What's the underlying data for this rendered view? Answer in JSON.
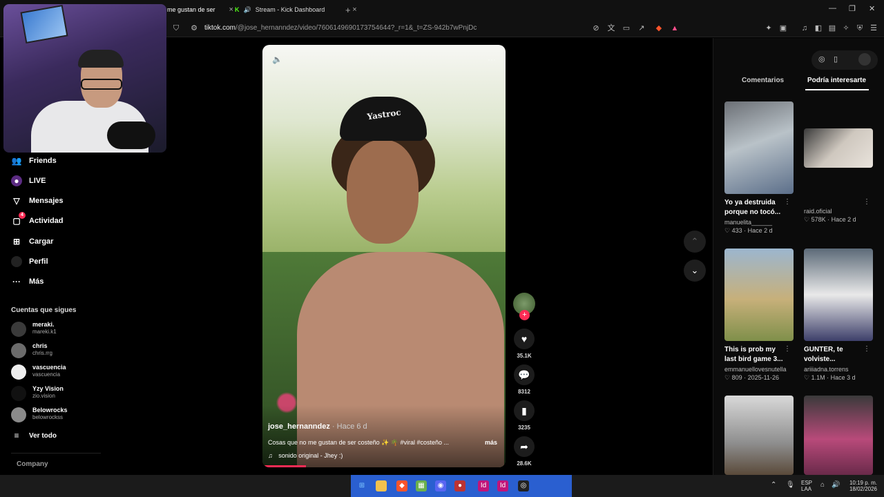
{
  "browser": {
    "tabs": [
      {
        "label": "me gustan de ser",
        "active": true
      },
      {
        "label": "Stream - Kick Dashboard",
        "active": false
      }
    ],
    "url_domain": "tiktok.com",
    "url_path": "/@jose_hernanndez/video/7606149690173754644?_r=1&_t=ZS-942b7wPnjDc"
  },
  "sidebar": {
    "items": [
      {
        "label": "Friends",
        "icon": "friends-icon"
      },
      {
        "label": "LIVE",
        "icon": "live-icon"
      },
      {
        "label": "Mensajes",
        "icon": "messages-icon"
      },
      {
        "label": "Actividad",
        "icon": "activity-icon",
        "badge": "4"
      },
      {
        "label": "Cargar",
        "icon": "upload-icon"
      },
      {
        "label": "Perfil",
        "icon": "profile-icon"
      },
      {
        "label": "Más",
        "icon": "more-icon"
      }
    ],
    "following_title": "Cuentas que sigues",
    "following": [
      {
        "name": "meraki.",
        "handle": "mareki.k1"
      },
      {
        "name": "chris",
        "handle": "chris.rrg"
      },
      {
        "name": "vascuencia",
        "handle": "vascuencia"
      },
      {
        "name": "Yzy Vision",
        "handle": "zio.vision"
      },
      {
        "name": "Belowrocks",
        "handle": "belowrockss"
      }
    ],
    "see_all": "Ver todo",
    "company": "Company"
  },
  "video": {
    "author": "jose_hernanndez",
    "posted": "· Hace 6 d",
    "description": "Cosas que no me gustan de ser costeño ✨ 🌴 #viral #costeño ...",
    "more": "más",
    "sound": "sonido original - Jhey :)",
    "cap_text": "Yastroc",
    "progress": 0.18
  },
  "actions": {
    "likes": "35.1K",
    "comments": "8312",
    "saves": "3235",
    "shares": "28.6K"
  },
  "right_panel": {
    "tabs": [
      "Comentarios",
      "Podría interesarte"
    ],
    "cards": [
      {
        "title": "Yo ya destruida porque no tocó...",
        "author": "manuelita______",
        "likes": "433",
        "when": "Hace 2 d"
      },
      {
        "title": "",
        "author": "raid.oficial",
        "likes": "578K",
        "when": "Hace 2 d"
      },
      {
        "title": "This is prob my last bird game 3...",
        "author": "emmanuellovesnutella",
        "likes": "809",
        "when": "2025-11-26"
      },
      {
        "title": "GUNTER, te volviste...",
        "author": "ariiiadna.torrens",
        "likes": "1.1M",
        "when": "Hace 3 d"
      }
    ]
  },
  "taskbar": {
    "lang_top": "ESP",
    "lang_bottom": "LAA",
    "time": "10:19 p. m.",
    "date": "18/02/2026"
  },
  "colors": {
    "accent": "#fe2c55",
    "background": "#000000"
  }
}
